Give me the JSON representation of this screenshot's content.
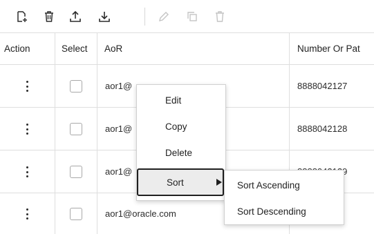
{
  "toolbar": {
    "buttons": [
      {
        "icon": "add-row-icon",
        "enabled": true
      },
      {
        "icon": "delete-all-icon",
        "enabled": true
      },
      {
        "icon": "upload-icon",
        "enabled": true
      },
      {
        "icon": "download-icon",
        "enabled": true
      },
      {
        "icon": "edit-icon",
        "enabled": false
      },
      {
        "icon": "duplicate-icon",
        "enabled": false
      },
      {
        "icon": "delete-icon",
        "enabled": false
      }
    ]
  },
  "table": {
    "headers": [
      "Action",
      "Select",
      "AoR",
      "Number Or Pat"
    ],
    "rows": [
      {
        "aor": "aor1@",
        "number": "8888042127"
      },
      {
        "aor": "aor1@",
        "number": "8888042128"
      },
      {
        "aor": "aor1@",
        "number": "8888042129"
      },
      {
        "aor": "aor1@oracle.com",
        "number": ""
      }
    ]
  },
  "context_menu": {
    "items": [
      "Edit",
      "Copy",
      "Delete",
      "Sort"
    ],
    "submenu": [
      "Sort Ascending",
      "Sort Descending"
    ]
  },
  "colors": {
    "text": "#1f1f1f",
    "disabled_icon": "#c4c4c4",
    "grid_line": "#dedede",
    "focus_border": "#1f1f1f"
  }
}
